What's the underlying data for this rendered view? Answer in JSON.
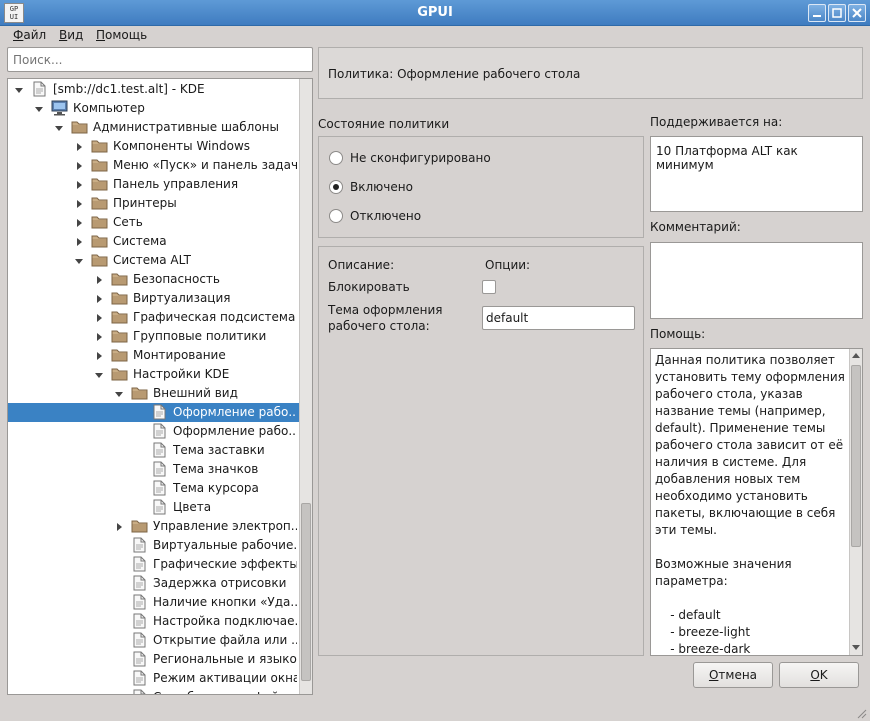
{
  "window": {
    "title": "GPUI",
    "icon_text": "GP\nUI"
  },
  "menu": [
    {
      "label": "Файл",
      "mnemonic": "Ф",
      "rest": "айл"
    },
    {
      "label": "Вид",
      "mnemonic": "В",
      "rest": "ид"
    },
    {
      "label": "Помощь",
      "mnemonic": "П",
      "rest": "омощь"
    }
  ],
  "search": {
    "placeholder": "Поиск..."
  },
  "tree": [
    {
      "label": "[smb://dc1.test.alt] - KDE",
      "level": 0,
      "icon": "document-icon",
      "expanded": true
    },
    {
      "label": "Компьютер",
      "level": 1,
      "icon": "computer-icon",
      "expanded": true
    },
    {
      "label": "Административные шаблоны",
      "level": 2,
      "icon": "folder-icon",
      "expanded": true
    },
    {
      "label": "Компоненты Windows",
      "level": 3,
      "icon": "folder-icon",
      "expanded": false
    },
    {
      "label": "Меню «Пуск» и панель задач",
      "level": 3,
      "icon": "folder-icon",
      "expanded": false
    },
    {
      "label": "Панель управления",
      "level": 3,
      "icon": "folder-icon",
      "expanded": false
    },
    {
      "label": "Принтеры",
      "level": 3,
      "icon": "folder-icon",
      "expanded": false
    },
    {
      "label": "Сеть",
      "level": 3,
      "icon": "folder-icon",
      "expanded": false
    },
    {
      "label": "Система",
      "level": 3,
      "icon": "folder-icon",
      "expanded": false
    },
    {
      "label": "Система ALT",
      "level": 3,
      "icon": "folder-icon",
      "expanded": true
    },
    {
      "label": "Безопасность",
      "level": 4,
      "icon": "folder-icon",
      "expanded": false
    },
    {
      "label": "Виртуализация",
      "level": 4,
      "icon": "folder-icon",
      "expanded": false
    },
    {
      "label": "Графическая подсистема",
      "level": 4,
      "icon": "folder-icon",
      "expanded": false
    },
    {
      "label": "Групповые политики",
      "level": 4,
      "icon": "folder-icon",
      "expanded": false
    },
    {
      "label": "Монтирование",
      "level": 4,
      "icon": "folder-icon",
      "expanded": false
    },
    {
      "label": "Настройки KDE",
      "level": 4,
      "icon": "folder-icon",
      "expanded": true
    },
    {
      "label": "Внешний вид",
      "level": 5,
      "icon": "folder-icon",
      "expanded": true
    },
    {
      "label": "Оформление рабо...",
      "level": 6,
      "icon": "document-icon",
      "selected": true
    },
    {
      "label": "Оформление рабо...",
      "level": 6,
      "icon": "document-icon"
    },
    {
      "label": "Тема заставки",
      "level": 6,
      "icon": "document-icon"
    },
    {
      "label": "Тема значков",
      "level": 6,
      "icon": "document-icon"
    },
    {
      "label": "Тема курсора",
      "level": 6,
      "icon": "document-icon"
    },
    {
      "label": "Цвета",
      "level": 6,
      "icon": "document-icon"
    },
    {
      "label": "Управление электроп...",
      "level": 5,
      "icon": "folder-icon",
      "expanded": false
    },
    {
      "label": "Виртуальные рабочие...",
      "level": 5,
      "icon": "document-icon"
    },
    {
      "label": "Графические эффекты",
      "level": 5,
      "icon": "document-icon"
    },
    {
      "label": "Задержка отрисовки",
      "level": 5,
      "icon": "document-icon"
    },
    {
      "label": "Наличие кнопки «Уда...",
      "level": 5,
      "icon": "document-icon"
    },
    {
      "label": "Настройка подключае...",
      "level": 5,
      "icon": "document-icon"
    },
    {
      "label": "Открытие файла или ...",
      "level": 5,
      "icon": "document-icon"
    },
    {
      "label": "Региональные и языко...",
      "level": 5,
      "icon": "document-icon"
    },
    {
      "label": "Режим активации окна",
      "level": 5,
      "icon": "document-icon"
    },
    {
      "label": "Служба поиска файлов",
      "level": 5,
      "icon": "document-icon"
    }
  ],
  "policy": {
    "header": "Политика: Оформление рабочего стола",
    "state_label": "Состояние политики",
    "states": [
      {
        "label": "Не сконфигурировано",
        "checked": false
      },
      {
        "label": "Включено",
        "checked": true
      },
      {
        "label": "Отключено",
        "checked": false
      }
    ],
    "description_label": "Описание:",
    "options_label": "Опции:",
    "block_label": "Блокировать",
    "block_checked": false,
    "theme_label_line1": "Тема оформления",
    "theme_label_line2": "рабочего стола:",
    "theme_value": "default",
    "supported_label": "Поддерживается на:",
    "supported_value": "10 Платформа ALT как минимум",
    "comment_label": "Комментарий:",
    "comment_value": "",
    "help_label": "Помощь:",
    "help_text": "Данная политика позволяет установить тему оформления рабочего стола, указав название темы (например, default). Применение темы рабочего стола зависит от её наличия в системе. Для добавления новых тем необходимо установить пакеты, включающие в себя эти темы.\n\nВозможные значения параметра:\n\n    - default\n    - breeze-light\n    - breeze-dark"
  },
  "buttons": {
    "cancel": {
      "label": "Отмена",
      "mnemonic": "О",
      "rest": "тмена"
    },
    "ok": {
      "label": "OK",
      "mnemonic": "O",
      "rest": "K"
    }
  },
  "colors": {
    "titlebar": "#4a88c8",
    "selection": "#3a82c4",
    "folder": "#b89a72"
  }
}
